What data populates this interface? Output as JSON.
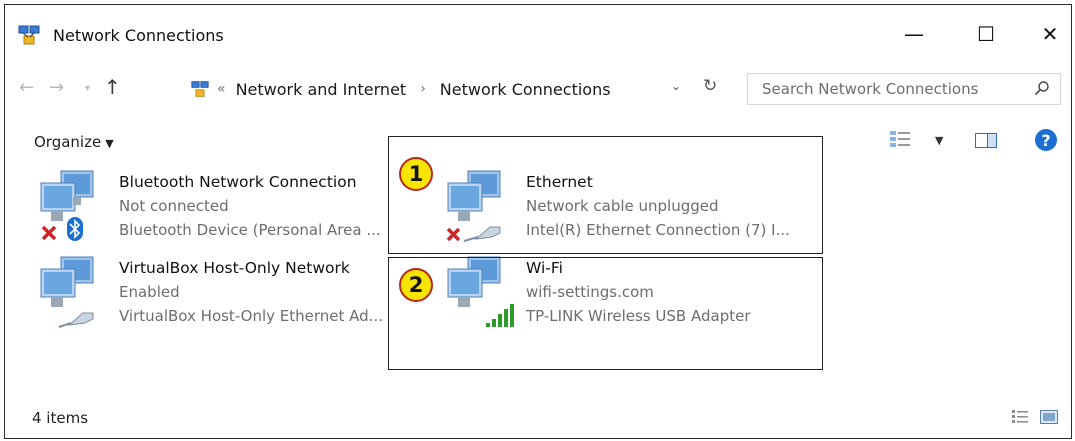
{
  "window": {
    "title": "Network Connections",
    "minimize_glyph": "—",
    "maximize_glyph": "☐",
    "close_glyph": "✕"
  },
  "address_bar": {
    "overflow_glyph": "«",
    "breadcrumbs": [
      "Network and Internet",
      "Network Connections"
    ],
    "separator_glyph": "›"
  },
  "search": {
    "placeholder": "Search Network Connections"
  },
  "toolbar": {
    "organize_label": "Organize",
    "help_glyph": "?"
  },
  "connections": [
    {
      "name": "Bluetooth Network Connection",
      "status": "Not connected",
      "device": "Bluetooth Device (Personal Area ...",
      "icon": "network-computers-icon",
      "overlay": "bluetooth-icon",
      "disconnected": true
    },
    {
      "name": "Ethernet",
      "status": "Network cable unplugged",
      "device": "Intel(R) Ethernet Connection (7) I...",
      "icon": "network-computers-icon",
      "overlay": "ethernet-cable-icon",
      "disconnected": true
    },
    {
      "name": "VirtualBox Host-Only Network",
      "status": "Enabled",
      "device": "VirtualBox Host-Only Ethernet Ad...",
      "icon": "network-computers-icon",
      "overlay": "ethernet-cable-icon",
      "disconnected": false
    },
    {
      "name": "Wi-Fi",
      "status": "wifi-settings.com",
      "device": "TP-LINK Wireless USB Adapter",
      "icon": "network-computers-icon",
      "overlay": "signal-bars-icon",
      "disconnected": false
    }
  ],
  "annotations": [
    "1",
    "2"
  ],
  "status_bar": {
    "item_count": "4 items"
  },
  "colors": {
    "annotation_badge": "#f7e400",
    "annotation_badge_border": "#b62a1a",
    "accent_blue": "#1a6fd0",
    "error_red": "#d0262a",
    "signal_green": "#2e9a2a"
  }
}
